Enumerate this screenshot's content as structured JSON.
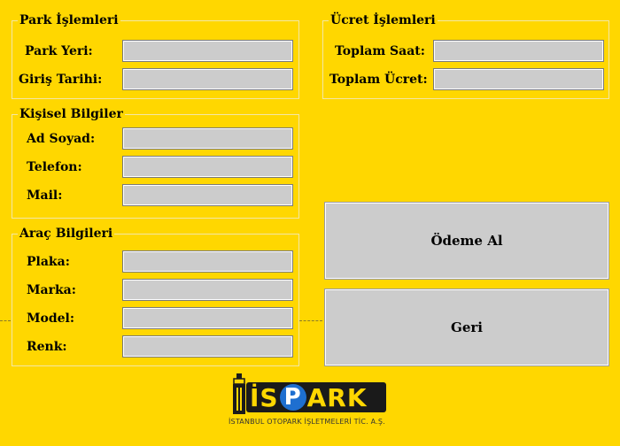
{
  "park": {
    "legend": "Park İşlemleri",
    "park_yeri_label": "Park Yeri:",
    "park_yeri_value": "",
    "giris_tarihi_label": "Giriş Tarihi:",
    "giris_tarihi_value": ""
  },
  "kisisel": {
    "legend": "Kişisel Bilgiler",
    "ad_soyad_label": "Ad Soyad:",
    "ad_soyad_value": "",
    "telefon_label": "Telefon:",
    "telefon_value": "",
    "mail_label": "Mail:",
    "mail_value": ""
  },
  "arac": {
    "legend": "Araç Bilgileri",
    "plaka_label": "Plaka:",
    "plaka_value": "",
    "marka_label": "Marka:",
    "marka_value": "",
    "model_label": "Model:",
    "model_value": "",
    "renk_label": "Renk:",
    "renk_value": ""
  },
  "ucret": {
    "legend": "Ücret İşlemleri",
    "toplam_saat_label": "Toplam Saat:",
    "toplam_saat_value": "",
    "toplam_ucret_label": "Toplam Ücret:",
    "toplam_ucret_value": ""
  },
  "buttons": {
    "odeme_al": "Ödeme Al",
    "geri": "Geri"
  },
  "logo": {
    "part_is": "İS",
    "part_p": "P",
    "part_ark": "ARK",
    "subtitle": "İSTANBUL OTOPARK İŞLETMELERİ TİC. A.Ş."
  },
  "colors": {
    "background": "#ffd700",
    "field": "#cccccc",
    "logo_blue": "#1e6fd0"
  }
}
